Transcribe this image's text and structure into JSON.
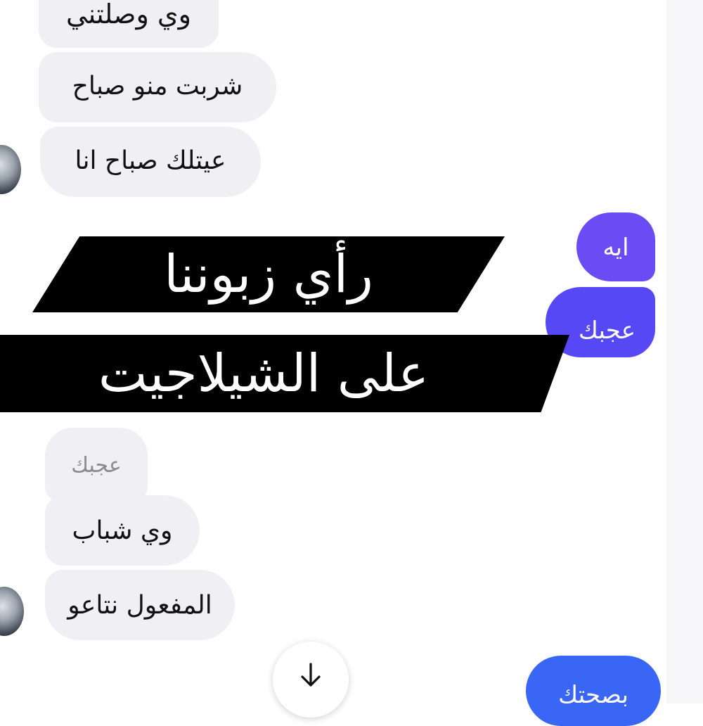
{
  "colors": {
    "incoming_bubble": "#efeff4",
    "outgoing_purple": "#6a4cf5",
    "outgoing_blue": "#3a66f6",
    "banner_bg": "#000000",
    "banner_text": "#ffffff"
  },
  "messages": {
    "incoming": [
      {
        "text": "وي وصلتني"
      },
      {
        "text": "شربت منو صباح"
      },
      {
        "text": "عيتلك صباح انا"
      },
      {
        "text": "عجبك",
        "reaction": true
      },
      {
        "text": "وي شباب"
      },
      {
        "text": "المفعول نتاعو"
      }
    ],
    "outgoing": [
      {
        "text": "ايه"
      },
      {
        "text": "عجبك"
      },
      {
        "text": "بصحتك"
      }
    ]
  },
  "overlay": {
    "line1": "رأي زبوننا",
    "line2": "على الشيلاجيت"
  },
  "scroll_button": {
    "icon": "arrow-down-icon"
  }
}
